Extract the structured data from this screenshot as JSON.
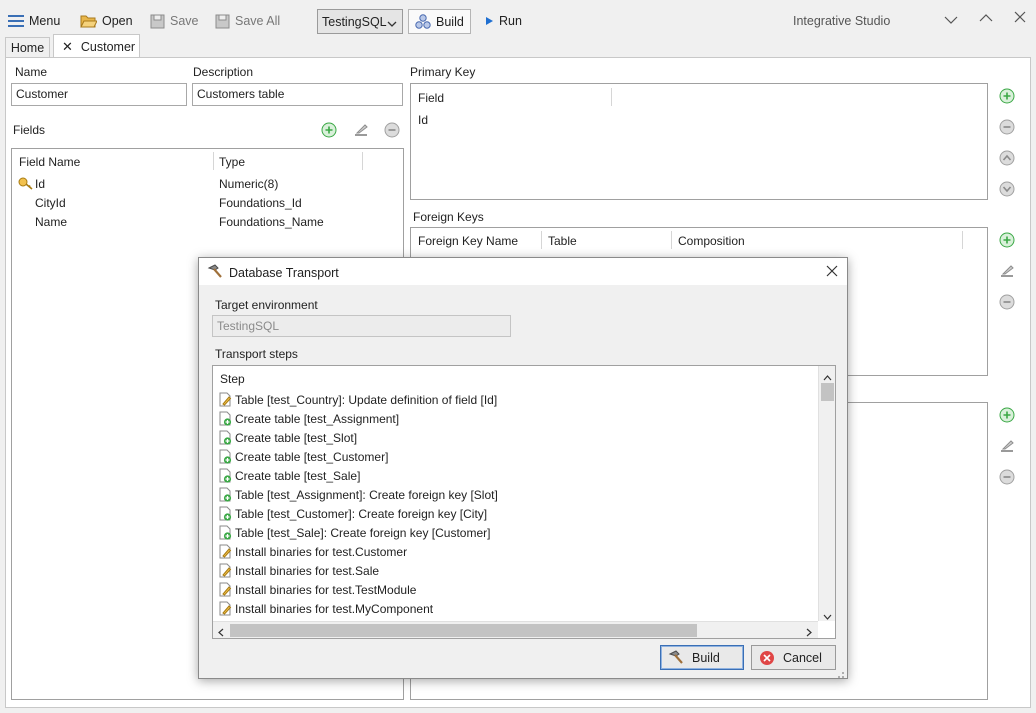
{
  "toolbar": {
    "menu": "Menu",
    "open": "Open",
    "save": "Save",
    "save_all": "Save All",
    "environment": "TestingSQL",
    "build": "Build",
    "run": "Run",
    "app_title": "Integrative Studio"
  },
  "tabs": {
    "home": "Home",
    "customer": "Customer"
  },
  "editor": {
    "name_label": "Name",
    "name_value": "Customer",
    "description_label": "Description",
    "description_value": "Customers table",
    "fields_label": "Fields",
    "fields_columns": [
      "Field Name",
      "Type"
    ],
    "fields_rows": [
      {
        "name": "Id",
        "type": "Numeric(8)"
      },
      {
        "name": "CityId",
        "type": "Foundations_Id"
      },
      {
        "name": "Name",
        "type": "Foundations_Name"
      }
    ],
    "primary_key_label": "Primary Key",
    "primary_key_column": "Field",
    "primary_key_rows": [
      "Id"
    ],
    "foreign_keys_label": "Foreign Keys",
    "foreign_keys_columns": [
      "Foreign Key Name",
      "Table",
      "Composition"
    ]
  },
  "dialog": {
    "title": "Database Transport",
    "target_env_label": "Target environment",
    "target_env_value": "TestingSQL",
    "steps_label": "Transport steps",
    "steps_column": "Step",
    "steps": [
      {
        "icon": "edit",
        "text": "Table [test_Country]: Update definition of field [Id]"
      },
      {
        "icon": "add",
        "text": "Create table [test_Assignment]"
      },
      {
        "icon": "add",
        "text": "Create table [test_Slot]"
      },
      {
        "icon": "add",
        "text": "Create table [test_Customer]"
      },
      {
        "icon": "add",
        "text": "Create table [test_Sale]"
      },
      {
        "icon": "add",
        "text": "Table [test_Assignment]: Create foreign key [Slot]"
      },
      {
        "icon": "add",
        "text": "Table [test_Customer]: Create foreign key [City]"
      },
      {
        "icon": "add",
        "text": "Table [test_Sale]: Create foreign key [Customer]"
      },
      {
        "icon": "edit",
        "text": "Install binaries for test.Customer"
      },
      {
        "icon": "edit",
        "text": "Install binaries for test.Sale"
      },
      {
        "icon": "edit",
        "text": "Install binaries for test.TestModule"
      },
      {
        "icon": "edit",
        "text": "Install binaries for test.MyComponent"
      }
    ],
    "build_button": "Build",
    "cancel_button": "Cancel"
  },
  "colors": {
    "accent_green": "#3aa845",
    "disabled_gray": "#9a9a9a",
    "cancel_red": "#e04646",
    "run_blue": "#1f6fd1"
  }
}
